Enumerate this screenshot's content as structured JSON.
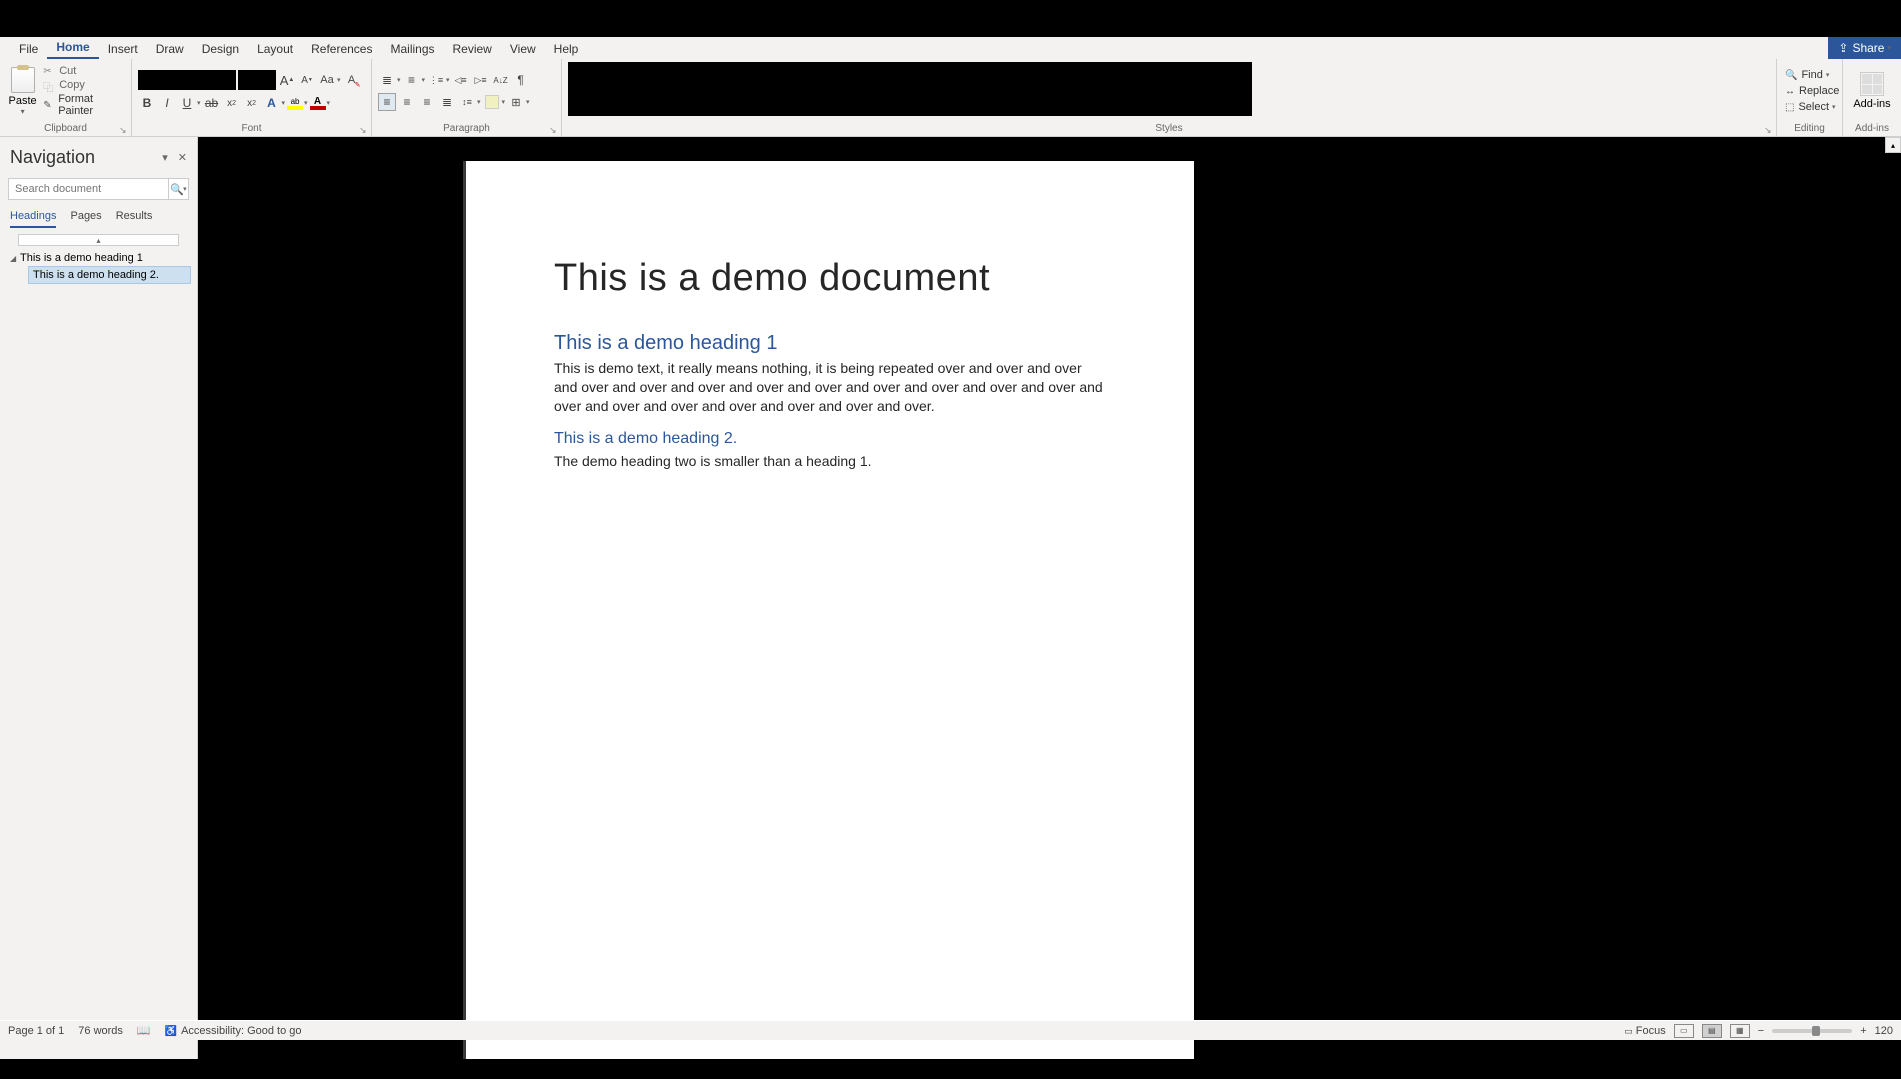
{
  "tabs": {
    "file": "File",
    "home": "Home",
    "insert": "Insert",
    "draw": "Draw",
    "design": "Design",
    "layout": "Layout",
    "references": "References",
    "mailings": "Mailings",
    "review": "Review",
    "view": "View",
    "help": "Help"
  },
  "share_label": "Share",
  "ribbon": {
    "clipboard": {
      "label": "Clipboard",
      "paste": "Paste",
      "cut": "Cut",
      "copy": "Copy",
      "format_painter": "Format Painter"
    },
    "font": {
      "label": "Font"
    },
    "paragraph": {
      "label": "Paragraph"
    },
    "styles": {
      "label": "Styles"
    },
    "editing": {
      "label": "Editing",
      "find": "Find",
      "replace": "Replace",
      "select": "Select"
    },
    "addins": {
      "label": "Add-ins",
      "button": "Add-ins"
    }
  },
  "nav": {
    "title": "Navigation",
    "search_placeholder": "Search document",
    "tabs": {
      "headings": "Headings",
      "pages": "Pages",
      "results": "Results"
    },
    "tree": {
      "h1": "This is a demo heading 1",
      "h2": "This is a demo heading 2."
    }
  },
  "document": {
    "title": "This is a demo document",
    "h1": "This is a demo heading 1",
    "p1": "This is demo text, it really means nothing, it is being repeated over and over and over and over and over and over and over and over and over and over and over and over and over and over and over and over and over and over and over.",
    "h2": "This is a demo heading 2.",
    "p2": "The demo heading two is smaller than a heading 1."
  },
  "status": {
    "page": "Page 1 of 1",
    "words": "76 words",
    "accessibility": "Accessibility: Good to go",
    "focus": "Focus",
    "zoom": "120"
  }
}
